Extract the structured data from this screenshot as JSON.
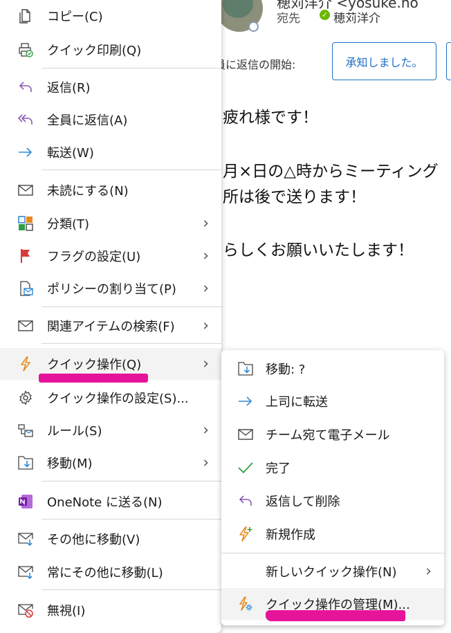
{
  "email": {
    "sender": "穂苅洋介 <yosuke.ho",
    "to_label": "宛先",
    "to_name": "穂苅洋介",
    "reply_prompt": "員に返信の開始:",
    "quick_reply": "承知しました。",
    "body": [
      "疲れ様です！",
      "月×日の△時からミーティング",
      "所は後で送ります！",
      "らしくお願いいたします！"
    ]
  },
  "menu": {
    "copy": "コピー(C)",
    "quick_print": "クイック印刷(Q)",
    "reply": "返信(R)",
    "reply_all": "全員に返信(A)",
    "forward": "転送(W)",
    "mark_unread": "未読にする(N)",
    "categorize": "分類(T)",
    "flag": "フラグの設定(U)",
    "policy": "ポリシーの割り当て(P)",
    "find_related": "関連アイテムの検索(F)",
    "quick_steps": "クイック操作(Q)",
    "quick_steps_settings": "クイック操作の設定(S)...",
    "rules": "ルール(S)",
    "move": "移動(M)",
    "onenote": "OneNote に送る(N)",
    "move_other": "その他に移動(V)",
    "always_move_other": "常にその他に移動(L)",
    "ignore": "無視(I)"
  },
  "submenu": {
    "move_to": "移動: ?",
    "to_manager": "上司に転送",
    "team_email": "チーム宛て電子メール",
    "done": "完了",
    "reply_delete": "返信して削除",
    "create_new": "新規作成",
    "new_quick_step": "新しいクイック操作(N)",
    "manage": "クイック操作の管理(M)..."
  },
  "colors": {
    "accent_blue": "#1f6fc5",
    "reply_purple": "#8a57b5",
    "forward_blue": "#2f8ad8",
    "done_green": "#2e9e47",
    "flag_red": "#d83b3b",
    "quick_orange": "#e88a1a",
    "highlight_pink": "#e6149a"
  }
}
